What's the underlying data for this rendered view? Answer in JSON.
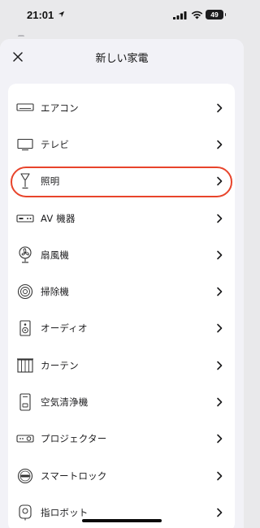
{
  "status_bar": {
    "time": "21:01",
    "battery": "49"
  },
  "header": {
    "title": "新しい家電",
    "close_icon": "close-icon"
  },
  "colors": {
    "highlight": "#e8442b",
    "background": "#f2f2f7",
    "card": "#ffffff"
  },
  "items": [
    {
      "label": "エアコン",
      "icon": "air-conditioner-icon"
    },
    {
      "label": "テレビ",
      "icon": "tv-icon"
    },
    {
      "label": "照明",
      "icon": "lighting-icon",
      "highlighted": true
    },
    {
      "label": "AV 機器",
      "icon": "av-device-icon"
    },
    {
      "label": "扇風機",
      "icon": "fan-icon"
    },
    {
      "label": "掃除機",
      "icon": "robot-vacuum-icon"
    },
    {
      "label": "オーディオ",
      "icon": "speaker-icon"
    },
    {
      "label": "カーテン",
      "icon": "curtain-icon"
    },
    {
      "label": "空気清浄機",
      "icon": "air-purifier-icon"
    },
    {
      "label": "プロジェクター",
      "icon": "projector-icon"
    },
    {
      "label": "スマートロック",
      "icon": "smart-lock-icon"
    },
    {
      "label": "指ロボット",
      "icon": "finger-robot-icon"
    }
  ]
}
